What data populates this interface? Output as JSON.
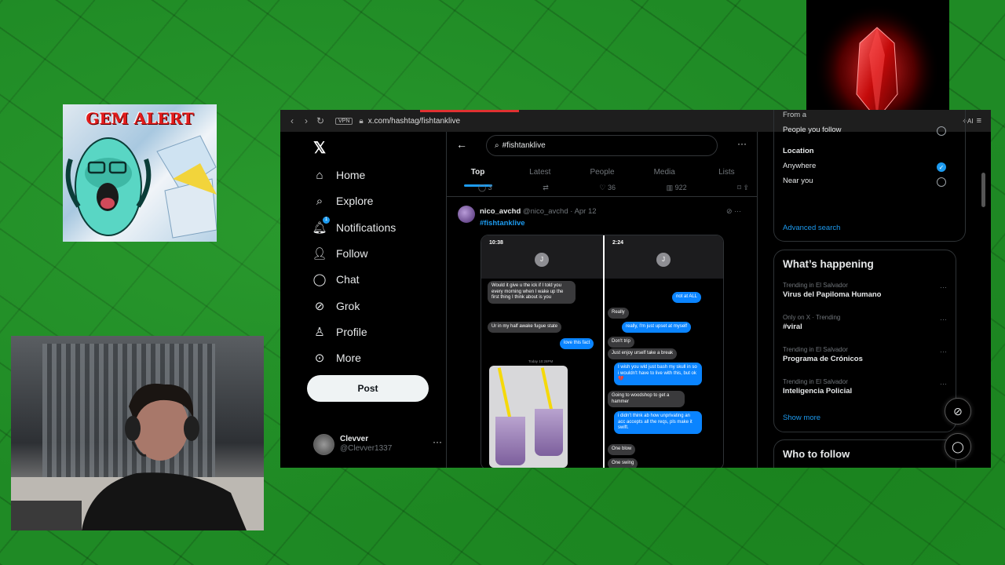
{
  "gem_card": {
    "title": "GEM ALERT"
  },
  "browser": {
    "url": "x.com/hashtag/fishtanklive",
    "vpn_label": "VPN",
    "ai_label": "AI"
  },
  "nav": {
    "items": [
      {
        "label": "Home",
        "icon": "home-icon"
      },
      {
        "label": "Explore",
        "icon": "search-icon"
      },
      {
        "label": "Notifications",
        "icon": "bell-icon",
        "badge": "1"
      },
      {
        "label": "Follow",
        "icon": "follow-icon"
      },
      {
        "label": "Chat",
        "icon": "chat-icon"
      },
      {
        "label": "Grok",
        "icon": "grok-icon"
      },
      {
        "label": "Profile",
        "icon": "profile-icon"
      },
      {
        "label": "More",
        "icon": "more-icon"
      }
    ],
    "post_label": "Post",
    "account": {
      "name": "Clevver",
      "handle": "@Clevver1337"
    }
  },
  "search": {
    "query": "#fishtanklive"
  },
  "tabs": [
    "Top",
    "Latest",
    "People",
    "Media",
    "Lists"
  ],
  "prev_tweet_actions": {
    "replies": "3",
    "likes": "36",
    "views": "922"
  },
  "tweet": {
    "name": "nico_avchd",
    "handle": "@nico_avchd",
    "date": "Apr 12",
    "hashtag": "#fishtanklive",
    "left_phone": {
      "time": "10:38",
      "messages": [
        "Would it give u the ick if I told you every morning when I wake up the first thing I think about is you",
        "Ur in my half awake fugue state",
        "love this fact"
      ],
      "day_label": "Today 10:28PM"
    },
    "right_phone": {
      "time": "2:24",
      "messages": [
        "not at ALL",
        "Really",
        "really, I'm just upset at myself",
        "Don't trip",
        "Just enjoy urself take a break",
        "I wish you wld just bash my skull in so i wouldn't have to live with this, but ok💔",
        "Going to woodshop to get a hammer",
        "i didn't think ab how unprivating an acc accepts all the reqs, pls make it swift.",
        "One blow",
        "One swing"
      ]
    }
  },
  "filters": {
    "from_label": "From a",
    "people_you_follow": "People you follow",
    "location_heading": "Location",
    "anywhere": "Anywhere",
    "near_you": "Near you",
    "advanced_search": "Advanced search"
  },
  "happening": {
    "title": "What’s happening",
    "trends": [
      {
        "context": "Trending in El Salvador",
        "topic": "Virus del Papiloma Humano"
      },
      {
        "context": "Only on X · Trending",
        "topic": "#viral"
      },
      {
        "context": "Trending in El Salvador",
        "topic": "Programa de Crónicos"
      },
      {
        "context": "Trending in El Salvador",
        "topic": "Inteligencia Policial"
      }
    ],
    "show_more": "Show more"
  },
  "who_to_follow": {
    "title": "Who to follow"
  }
}
